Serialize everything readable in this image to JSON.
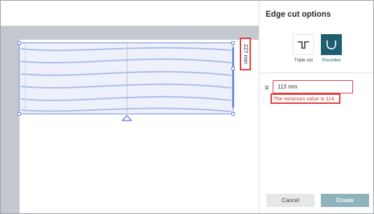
{
  "canvas": {
    "dimension_label": "227 mm"
  },
  "panel": {
    "title": "Edge cut options",
    "options": [
      {
        "label": "Triple cut",
        "icon": "triple-cut-icon",
        "selected": false
      },
      {
        "label": "Rounded",
        "icon": "rounded-cut-icon",
        "selected": true
      }
    ],
    "radius": {
      "label": "R",
      "value": "113 mm",
      "error": "The minimum value is 114."
    },
    "buttons": {
      "cancel": "Cancel",
      "create": "Create"
    }
  },
  "colors": {
    "accent": "#1f5e6e",
    "error": "#e03a3e",
    "selection": "#6f8fdc",
    "create_button": "#8fb2bd"
  }
}
